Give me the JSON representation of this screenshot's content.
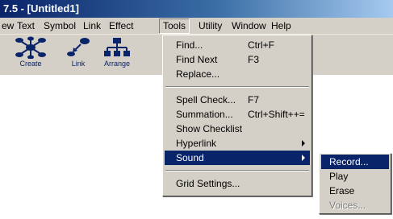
{
  "window": {
    "title": "7.5 - [Untitled1]"
  },
  "menubar": {
    "items": [
      {
        "label": "ew"
      },
      {
        "label": "Text"
      },
      {
        "label": "Symbol"
      },
      {
        "label": "Link"
      },
      {
        "label": "Effect"
      },
      {
        "label": "Tools"
      },
      {
        "label": "Utility"
      },
      {
        "label": "Window"
      },
      {
        "label": "Help"
      }
    ]
  },
  "toolbar": {
    "buttons": [
      {
        "label": "Create",
        "icon": "create-icon"
      },
      {
        "label": "Link",
        "icon": "link-icon"
      },
      {
        "label": "Arrange",
        "icon": "arrange-icon"
      }
    ]
  },
  "tools_menu": {
    "items": [
      {
        "label": "Find...",
        "shortcut": "Ctrl+F"
      },
      {
        "label": "Find Next",
        "shortcut": "F3"
      },
      {
        "label": "Replace...",
        "shortcut": ""
      },
      {
        "label": "Spell Check...",
        "shortcut": "F7"
      },
      {
        "label": "Summation...",
        "shortcut": "Ctrl+Shift++="
      },
      {
        "label": "Show Checklist",
        "shortcut": ""
      },
      {
        "label": "Hyperlink",
        "shortcut": ""
      },
      {
        "label": "Sound",
        "shortcut": ""
      },
      {
        "label": "Grid Settings...",
        "shortcut": ""
      }
    ]
  },
  "sound_menu": {
    "items": [
      {
        "label": "Record..."
      },
      {
        "label": "Play"
      },
      {
        "label": "Erase"
      },
      {
        "label": "Voices..."
      }
    ]
  },
  "colors": {
    "highlight": "#0a246a",
    "menu_face": "#d4d0c8",
    "title_start": "#0a246a",
    "title_end": "#a6caf0"
  }
}
